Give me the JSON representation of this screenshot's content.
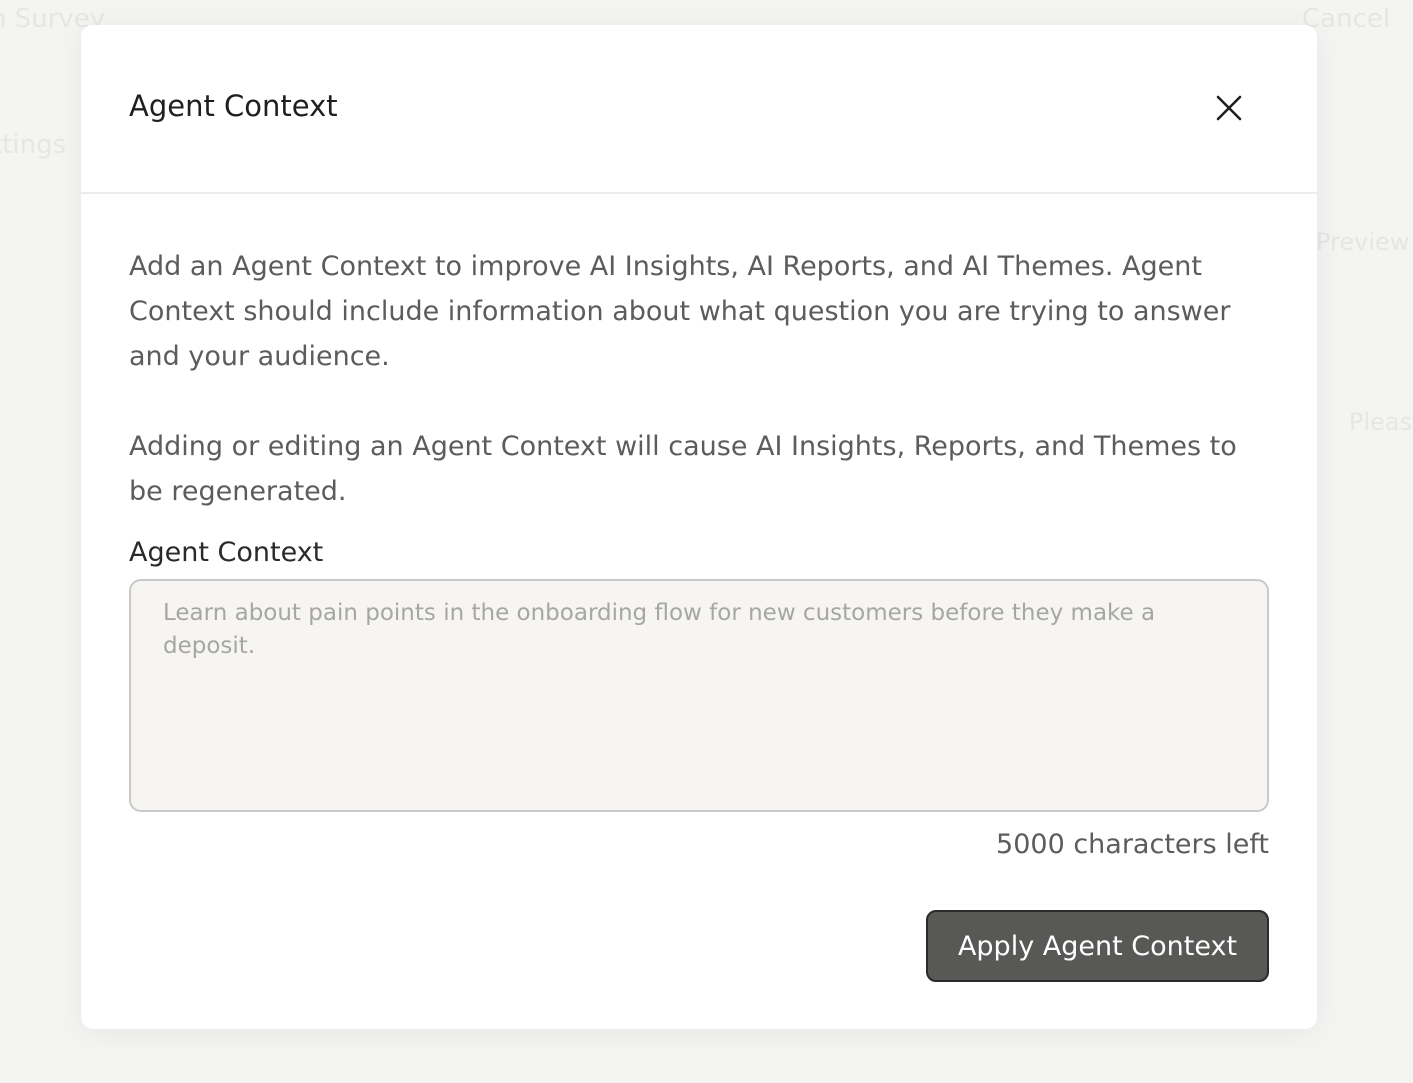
{
  "background": {
    "title_fragment": "n Survey",
    "cancel_label": "Cancel",
    "settings_fragment": "ttings",
    "preview_fragment": "Preview",
    "please_fragment": "Pleas"
  },
  "modal": {
    "title": "Agent Context",
    "close_icon": "close-icon",
    "description_1": "Add an Agent Context to improve AI Insights, AI Reports, and AI Themes. Agent Context should include information about what question you are trying to answer and your audience.",
    "description_2": "Adding or editing an Agent Context will cause AI Insights, Reports, and Themes to be regenerated.",
    "field_label": "Agent Context",
    "field_value": "",
    "field_placeholder": "Learn about pain points in the onboarding flow for new customers before they make a deposit.",
    "char_count": "5000 characters left",
    "apply_label": "Apply Agent Context"
  },
  "colors": {
    "button_bg": "#585856",
    "button_border": "#2b2b2a",
    "text_primary": "#1f1f1e",
    "text_secondary": "#5c5c5a",
    "textarea_bg": "#f6f5f3"
  }
}
